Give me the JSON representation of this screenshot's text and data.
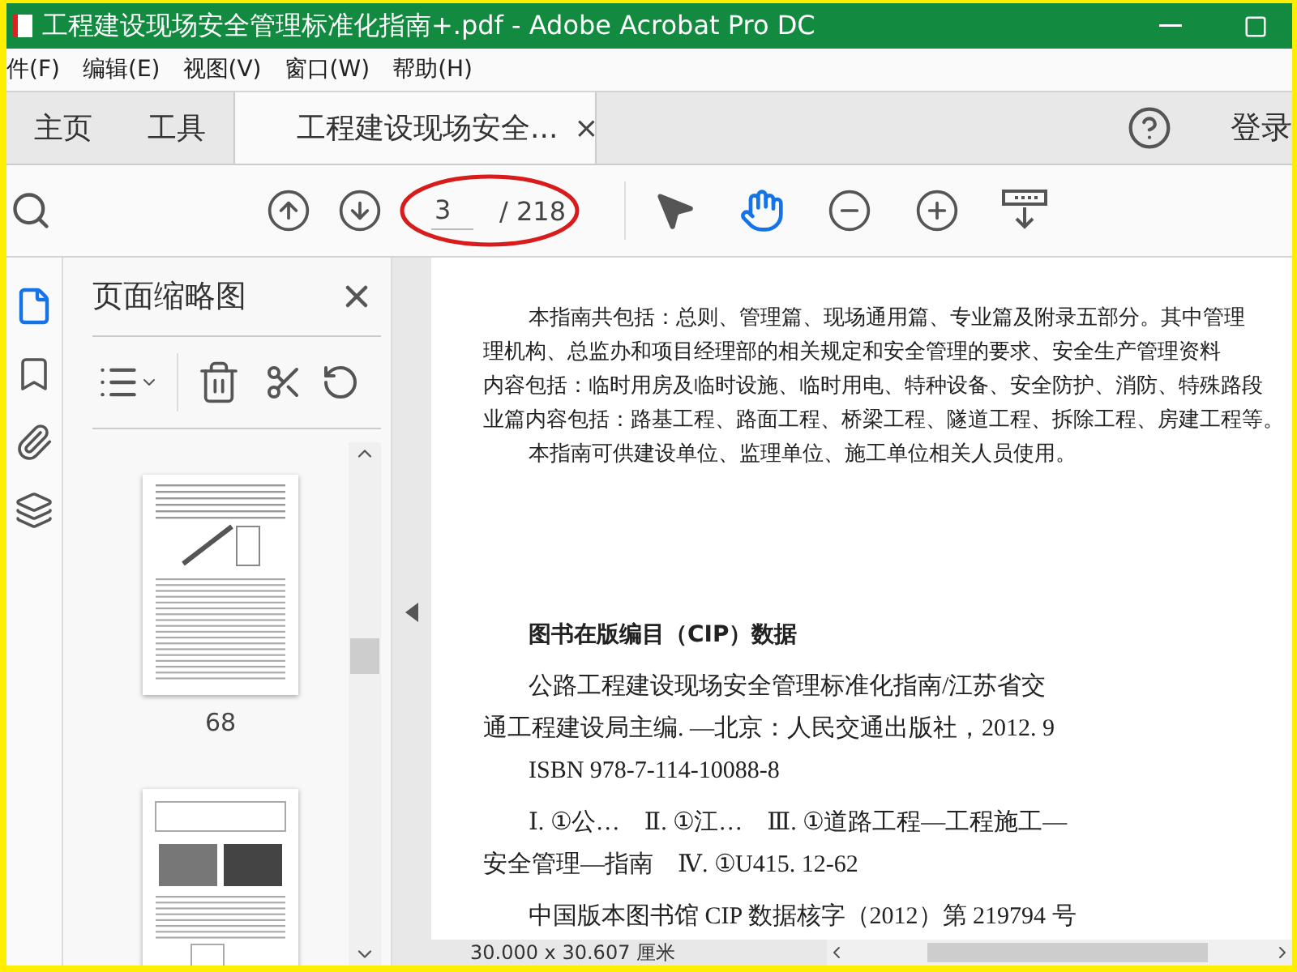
{
  "window": {
    "title": "工程建设现场安全管理标准化指南+.pdf - Adobe Acrobat Pro DC"
  },
  "menu": [
    "件(F)",
    "编辑(E)",
    "视图(V)",
    "窗口(W)",
    "帮助(H)"
  ],
  "tabs": [
    {
      "label": "主页",
      "kind": "nav",
      "selected": false
    },
    {
      "label": "工具",
      "kind": "nav",
      "selected": false
    },
    {
      "label": "工程建设现场安全...",
      "kind": "document",
      "selected": true,
      "close": "×"
    }
  ],
  "login": "登录",
  "toolbar": {
    "page_current": "3",
    "page_total": "/ 218",
    "tools": [
      {
        "kind": "pointer",
        "selected": false
      },
      {
        "kind": "hand",
        "selected": true
      }
    ]
  },
  "sidebar": {
    "title": "页面缩略图",
    "rail": [
      {
        "kind": "pages",
        "selected": true
      },
      {
        "kind": "bookmarks",
        "selected": false
      },
      {
        "kind": "attachments",
        "selected": false
      },
      {
        "kind": "layers",
        "selected": false
      }
    ],
    "thumbnails": [
      {
        "kind": "diagram",
        "label": "68"
      },
      {
        "kind": "photos"
      }
    ]
  },
  "document": {
    "lines": [
      {
        "text": "本指南共包括：总则、管理篇、现场通用篇、专业篇及附录五部分。其中管理",
        "indent": true
      },
      {
        "text": "理机构、总监办和项目经理部的相关规定和安全管理的要求、安全生产管理资料",
        "indent": false
      },
      {
        "text": "内容包括：临时用房及临时设施、临时用电、特种设备、安全防护、消防、特殊路段",
        "indent": false
      },
      {
        "text": "业篇内容包括：路基工程、路面工程、桥梁工程、隧道工程、拆除工程、房建工程等。",
        "indent": false
      },
      {
        "text": "本指南可供建设单位、监理单位、施工单位相关人员使用。",
        "indent": true
      }
    ],
    "cip_heading": "图书在版编目（CIP）数据",
    "cip_blocks": [
      {
        "lines": [
          {
            "text": "公路工程建设现场安全管理标准化指南/江苏省交",
            "indent": true
          },
          {
            "text": "通工程建设局主编. —北京：人民交通出版社，2012. 9",
            "indent": false
          },
          {
            "text": "ISBN  978-7-114-10088-8",
            "indent": true
          }
        ]
      },
      {
        "lines": [
          {
            "text": "Ⅰ. ①公…　Ⅱ. ①江…　Ⅲ. ①道路工程—工程施工—",
            "indent": true
          },
          {
            "text": "安全管理—指南　Ⅳ. ①U415. 12-62",
            "indent": false
          }
        ]
      },
      {
        "lines": [
          {
            "text": "中国版本图书馆 CIP 数据核字（2012）第 219794 号",
            "indent": true
          }
        ]
      }
    ]
  },
  "status": "30.000 x 30.607 厘米"
}
